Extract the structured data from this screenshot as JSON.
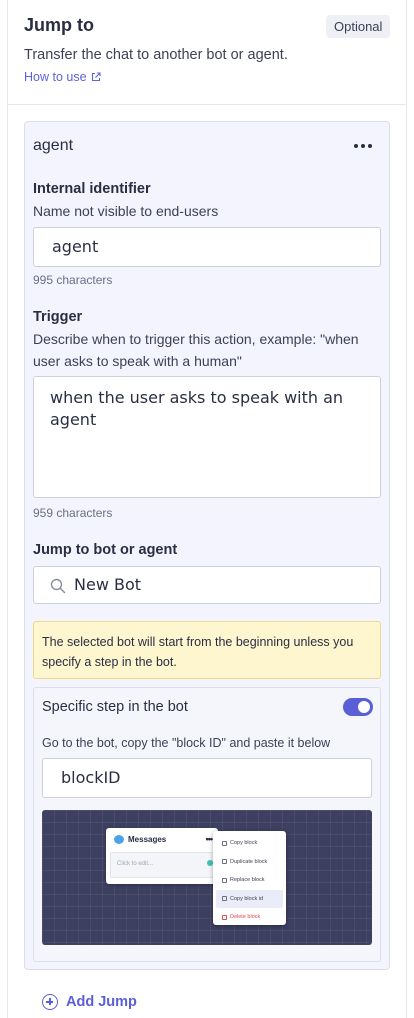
{
  "header": {
    "title": "Jump to",
    "badge": "Optional",
    "subtitle": "Transfer the chat to another bot or agent.",
    "how_to_use": "How to use"
  },
  "card": {
    "title": "agent",
    "internal_identifier": {
      "label": "Internal identifier",
      "description": "Name not visible to end-users",
      "value": "agent",
      "count": "995 characters"
    },
    "trigger": {
      "label": "Trigger",
      "description_line1": "Describe when to trigger this action, example: \"when",
      "description_line2": "user asks to speak with a human\"",
      "value": "when the user asks to speak with an agent",
      "count": "959 characters"
    },
    "jump_target": {
      "label": "Jump to bot or agent",
      "value": "New Bot"
    },
    "notice": "The selected bot will start from the beginning unless you specify a step in the bot.",
    "specific_step": {
      "label": "Specific step in the bot",
      "toggle_on": true,
      "description": "Go to the bot, copy the \"block ID\" and paste it below",
      "value": "blockID"
    },
    "preview": {
      "card_title": "Messages",
      "card_placeholder": "Click to edit...",
      "menu_items": [
        "Copy block",
        "Duplicate block",
        "Replace block",
        "Copy block id",
        "Delete block"
      ]
    }
  },
  "footer": {
    "add_jump": "Add Jump"
  },
  "colors": {
    "accent": "#5a5fd6",
    "card_bg": "#f3f4fd",
    "notice_bg": "#fdf6cf",
    "preview_bg": "#3d4060"
  }
}
